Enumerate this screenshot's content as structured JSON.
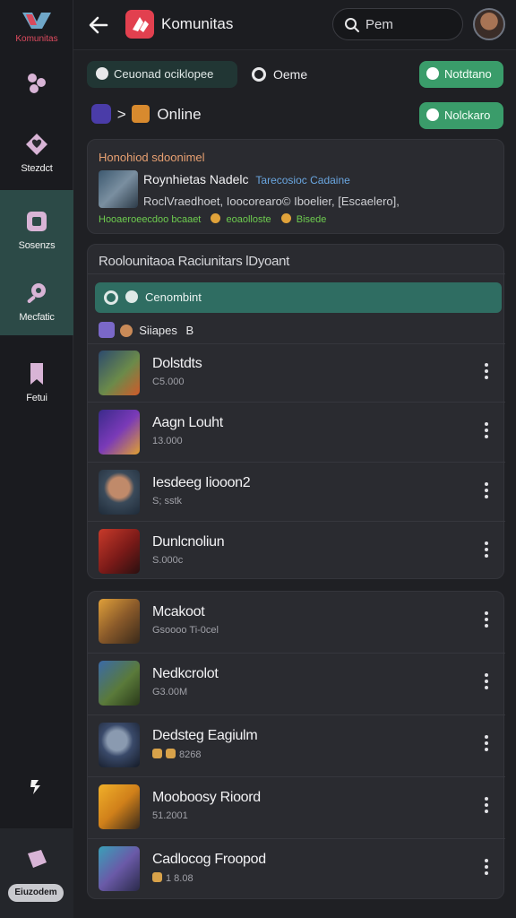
{
  "app": {
    "rail_logo_label": "Komunitas",
    "title": "Komunitas"
  },
  "search": {
    "value": "Pem"
  },
  "sidebar": {
    "items": [
      {
        "label": ""
      },
      {
        "label": "Stezdct"
      },
      {
        "label": "Sosenzs"
      },
      {
        "label": "Mecfatic"
      },
      {
        "label": "Fetui"
      },
      {
        "label": ""
      }
    ],
    "bottom_label": "Eiuzodem"
  },
  "filters": {
    "row1_chip": "Ceuonad ociklopee",
    "row1_item": "Oeme",
    "row1_action": "Notdtano",
    "row2_item": "Online",
    "row2_action": "Nolckaro"
  },
  "featured": {
    "heading": "Honohiod sdoonimel",
    "title": "Roynhietas Nadelc",
    "title_accent": "Tarecosioc Cadaine",
    "detail": "RoclVraedhoet, Ioocorearo© Iboelier, [Escaelero],",
    "tags": [
      "Hooaeroeecdoo bcaaet",
      "eoaolloste",
      "Bisede"
    ]
  },
  "community": {
    "heading": "Roolounitaoa Raciunitars lDyoant",
    "active_row": "Cenombint",
    "section_label": "Siiapes",
    "section_count": "B",
    "items": [
      {
        "title": "Dolstdts",
        "sub": "C5.000"
      },
      {
        "title": "Aagn Louht",
        "sub": "13.000"
      },
      {
        "title": "Iesdeeg Iiooon2",
        "sub": "S; sstk"
      },
      {
        "title": "Dunlcnoliun",
        "sub": "S.000c"
      }
    ]
  },
  "games": {
    "items": [
      {
        "title": "Mcakoot",
        "sub": "Gsoooo Ti-0cel"
      },
      {
        "title": "Nedkcrolot",
        "sub": "G3.00M"
      },
      {
        "title": "Dedsteg Eagiulm",
        "sub": "8268"
      },
      {
        "title": "Mooboosy Rioord",
        "sub": "51.2001"
      },
      {
        "title": "Cadlocog Froopod",
        "sub": "1 8.08"
      }
    ]
  },
  "colors": {
    "accent_green": "#3a9c6a",
    "accent_teal": "#2c6a60",
    "brand_red": "#e2404f"
  }
}
